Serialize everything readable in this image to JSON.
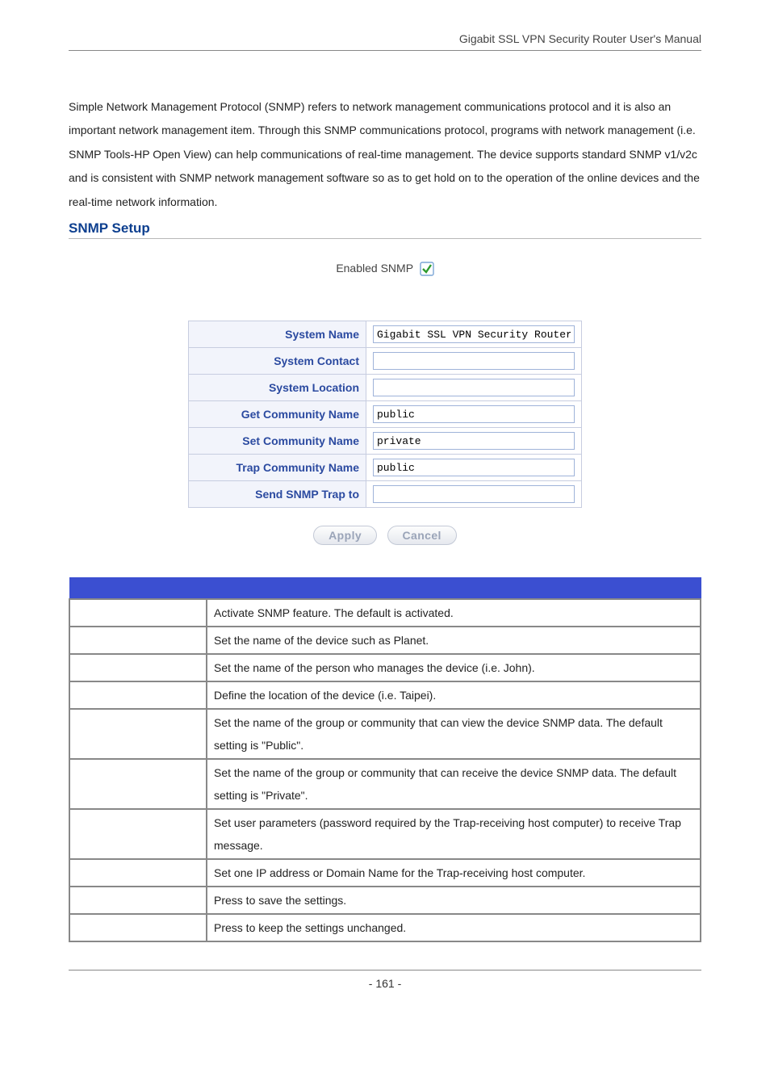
{
  "header": {
    "right": "Gigabit  SSL  VPN  Security  Router  User's  Manual"
  },
  "intro": "Simple Network Management Protocol (SNMP) refers to network management communications protocol and it is also an important network management item. Through this SNMP communications protocol, programs with network management (i.e. SNMP Tools-HP Open View) can help communications of real-time management. The device supports standard SNMP v1/v2c and is consistent with SNMP network management software so as to get hold on to the operation of the online devices and the real-time network information.",
  "section_title": "SNMP Setup",
  "enabled": {
    "label": "Enabled SNMP"
  },
  "snmp_fields": {
    "system_name": {
      "label": "System Name",
      "value": "Gigabit SSL VPN Security Router"
    },
    "system_contact": {
      "label": "System Contact",
      "value": ""
    },
    "system_location": {
      "label": "System Location",
      "value": ""
    },
    "get_community": {
      "label": "Get Community Name",
      "value": "public"
    },
    "set_community": {
      "label": "Set Community Name",
      "value": "private"
    },
    "trap_community": {
      "label": "Trap Community Name",
      "value": "public"
    },
    "send_trap_to": {
      "label": "Send SNMP Trap to",
      "value": ""
    }
  },
  "buttons": {
    "apply": "Apply",
    "cancel": "Cancel"
  },
  "desc_rows": [
    {
      "k": "",
      "v": "Activate SNMP feature. The default is activated."
    },
    {
      "k": "",
      "v": "Set the name of the device such as Planet."
    },
    {
      "k": "",
      "v": "Set the name of the person who manages the device (i.e. John)."
    },
    {
      "k": "",
      "v": "Define the location of the device (i.e. Taipei)."
    },
    {
      "k": "",
      "v": "Set the name of the group or community that can view the device SNMP data. The default setting is \"Public\"."
    },
    {
      "k": "",
      "v": "Set the name of the group or community that can receive the device SNMP data. The default setting is \"Private\"."
    },
    {
      "k": "",
      "v": "Set user parameters (password required by the Trap-receiving host computer) to receive Trap message."
    },
    {
      "k": "",
      "v": "Set one IP address or Domain Name for the Trap-receiving host computer."
    },
    {
      "k": "",
      "v": "Press              to save the settings."
    },
    {
      "k": "",
      "v": "Press                to keep the settings unchanged."
    }
  ],
  "footer": {
    "page": "- 161 -"
  }
}
